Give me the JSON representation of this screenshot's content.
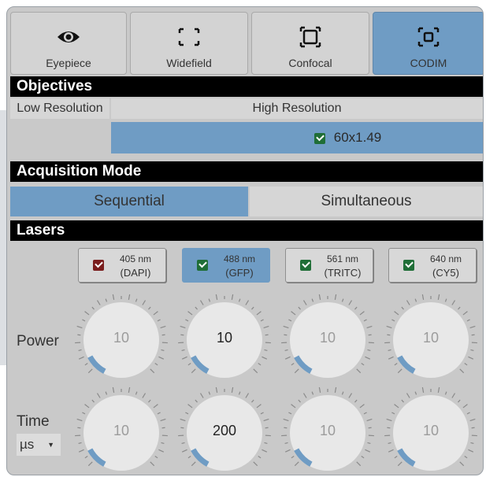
{
  "modes": [
    {
      "label": "Eyepiece",
      "icon": "eye-icon",
      "active": false
    },
    {
      "label": "Widefield",
      "icon": "widefield-frame-icon",
      "active": false
    },
    {
      "label": "Confocal",
      "icon": "confocal-frame-icon",
      "active": false
    },
    {
      "label": "CODIM",
      "icon": "codim-frame-icon",
      "active": true
    }
  ],
  "objectives": {
    "header": "Objectives",
    "low_resolution": "Low Resolution",
    "high_resolution": "High Resolution",
    "selected": "60x1.49"
  },
  "acquisition": {
    "header": "Acquisition Mode",
    "sequential": "Sequential",
    "simultaneous": "Simultaneous",
    "active": "Sequential"
  },
  "lasers": {
    "header": "Lasers",
    "channels": [
      {
        "wavelength": "405 nm",
        "dye": "(DAPI)",
        "checked": true,
        "color": "#7a1d1d",
        "active": false
      },
      {
        "wavelength": "488 nm",
        "dye": "(GFP)",
        "checked": true,
        "color": "#1f6e37",
        "active": true
      },
      {
        "wavelength": "561 nm",
        "dye": "(TRITC)",
        "checked": true,
        "color": "#1f6e37",
        "active": false
      },
      {
        "wavelength": "640 nm",
        "dye": "(CY5)",
        "checked": true,
        "color": "#1f6e37",
        "active": false
      }
    ],
    "power_label": "Power",
    "power_values": [
      "10",
      "10",
      "10",
      "10"
    ],
    "time_label": "Time",
    "time_unit": "µs",
    "time_values": [
      "10",
      "200",
      "10",
      "10"
    ]
  },
  "colors": {
    "accent": "#6f9cc4",
    "panel": "#c9c9c9",
    "header": "#000000"
  }
}
